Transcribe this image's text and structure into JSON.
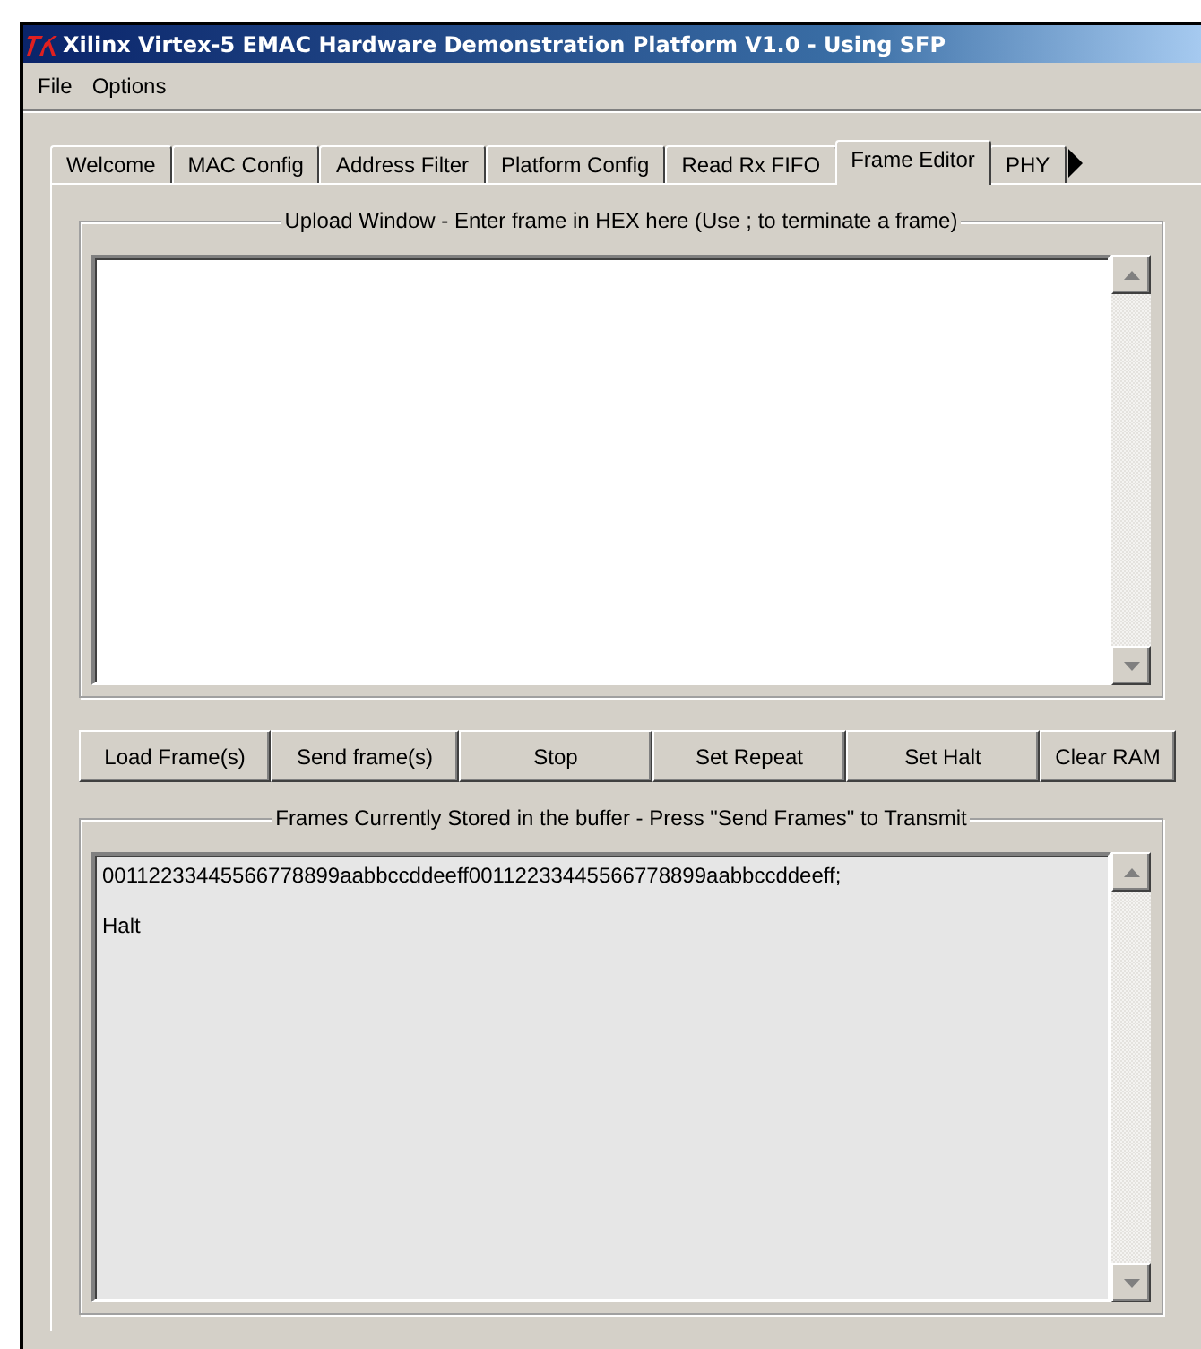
{
  "window": {
    "title": "Xilinx Virtex-5 EMAC Hardware Demonstration Platform V1.0 - Using SFP"
  },
  "menu": [
    "File",
    "Options"
  ],
  "tabs": [
    {
      "label": "Welcome",
      "selected": false
    },
    {
      "label": "MAC Config",
      "selected": false
    },
    {
      "label": "Address Filter",
      "selected": false
    },
    {
      "label": "Platform Config",
      "selected": false
    },
    {
      "label": "Read Rx FIFO",
      "selected": false
    },
    {
      "label": "Frame Editor",
      "selected": true
    },
    {
      "label": "PHY",
      "selected": false
    }
  ],
  "upload": {
    "legend": "Upload Window - Enter frame in HEX here (Use ; to terminate a frame)"
  },
  "buttons": [
    "Load Frame(s)",
    "Send frame(s)",
    "Stop",
    "Set Repeat",
    "Set Halt",
    "Clear RAM"
  ],
  "buffer": {
    "legend": "Frames Currently Stored in the buffer - Press \"Send Frames\" to Transmit",
    "lines": [
      "00112233445566778899aabbccddeeff00112233445566778899aabbccddeeff;",
      "Halt"
    ]
  }
}
